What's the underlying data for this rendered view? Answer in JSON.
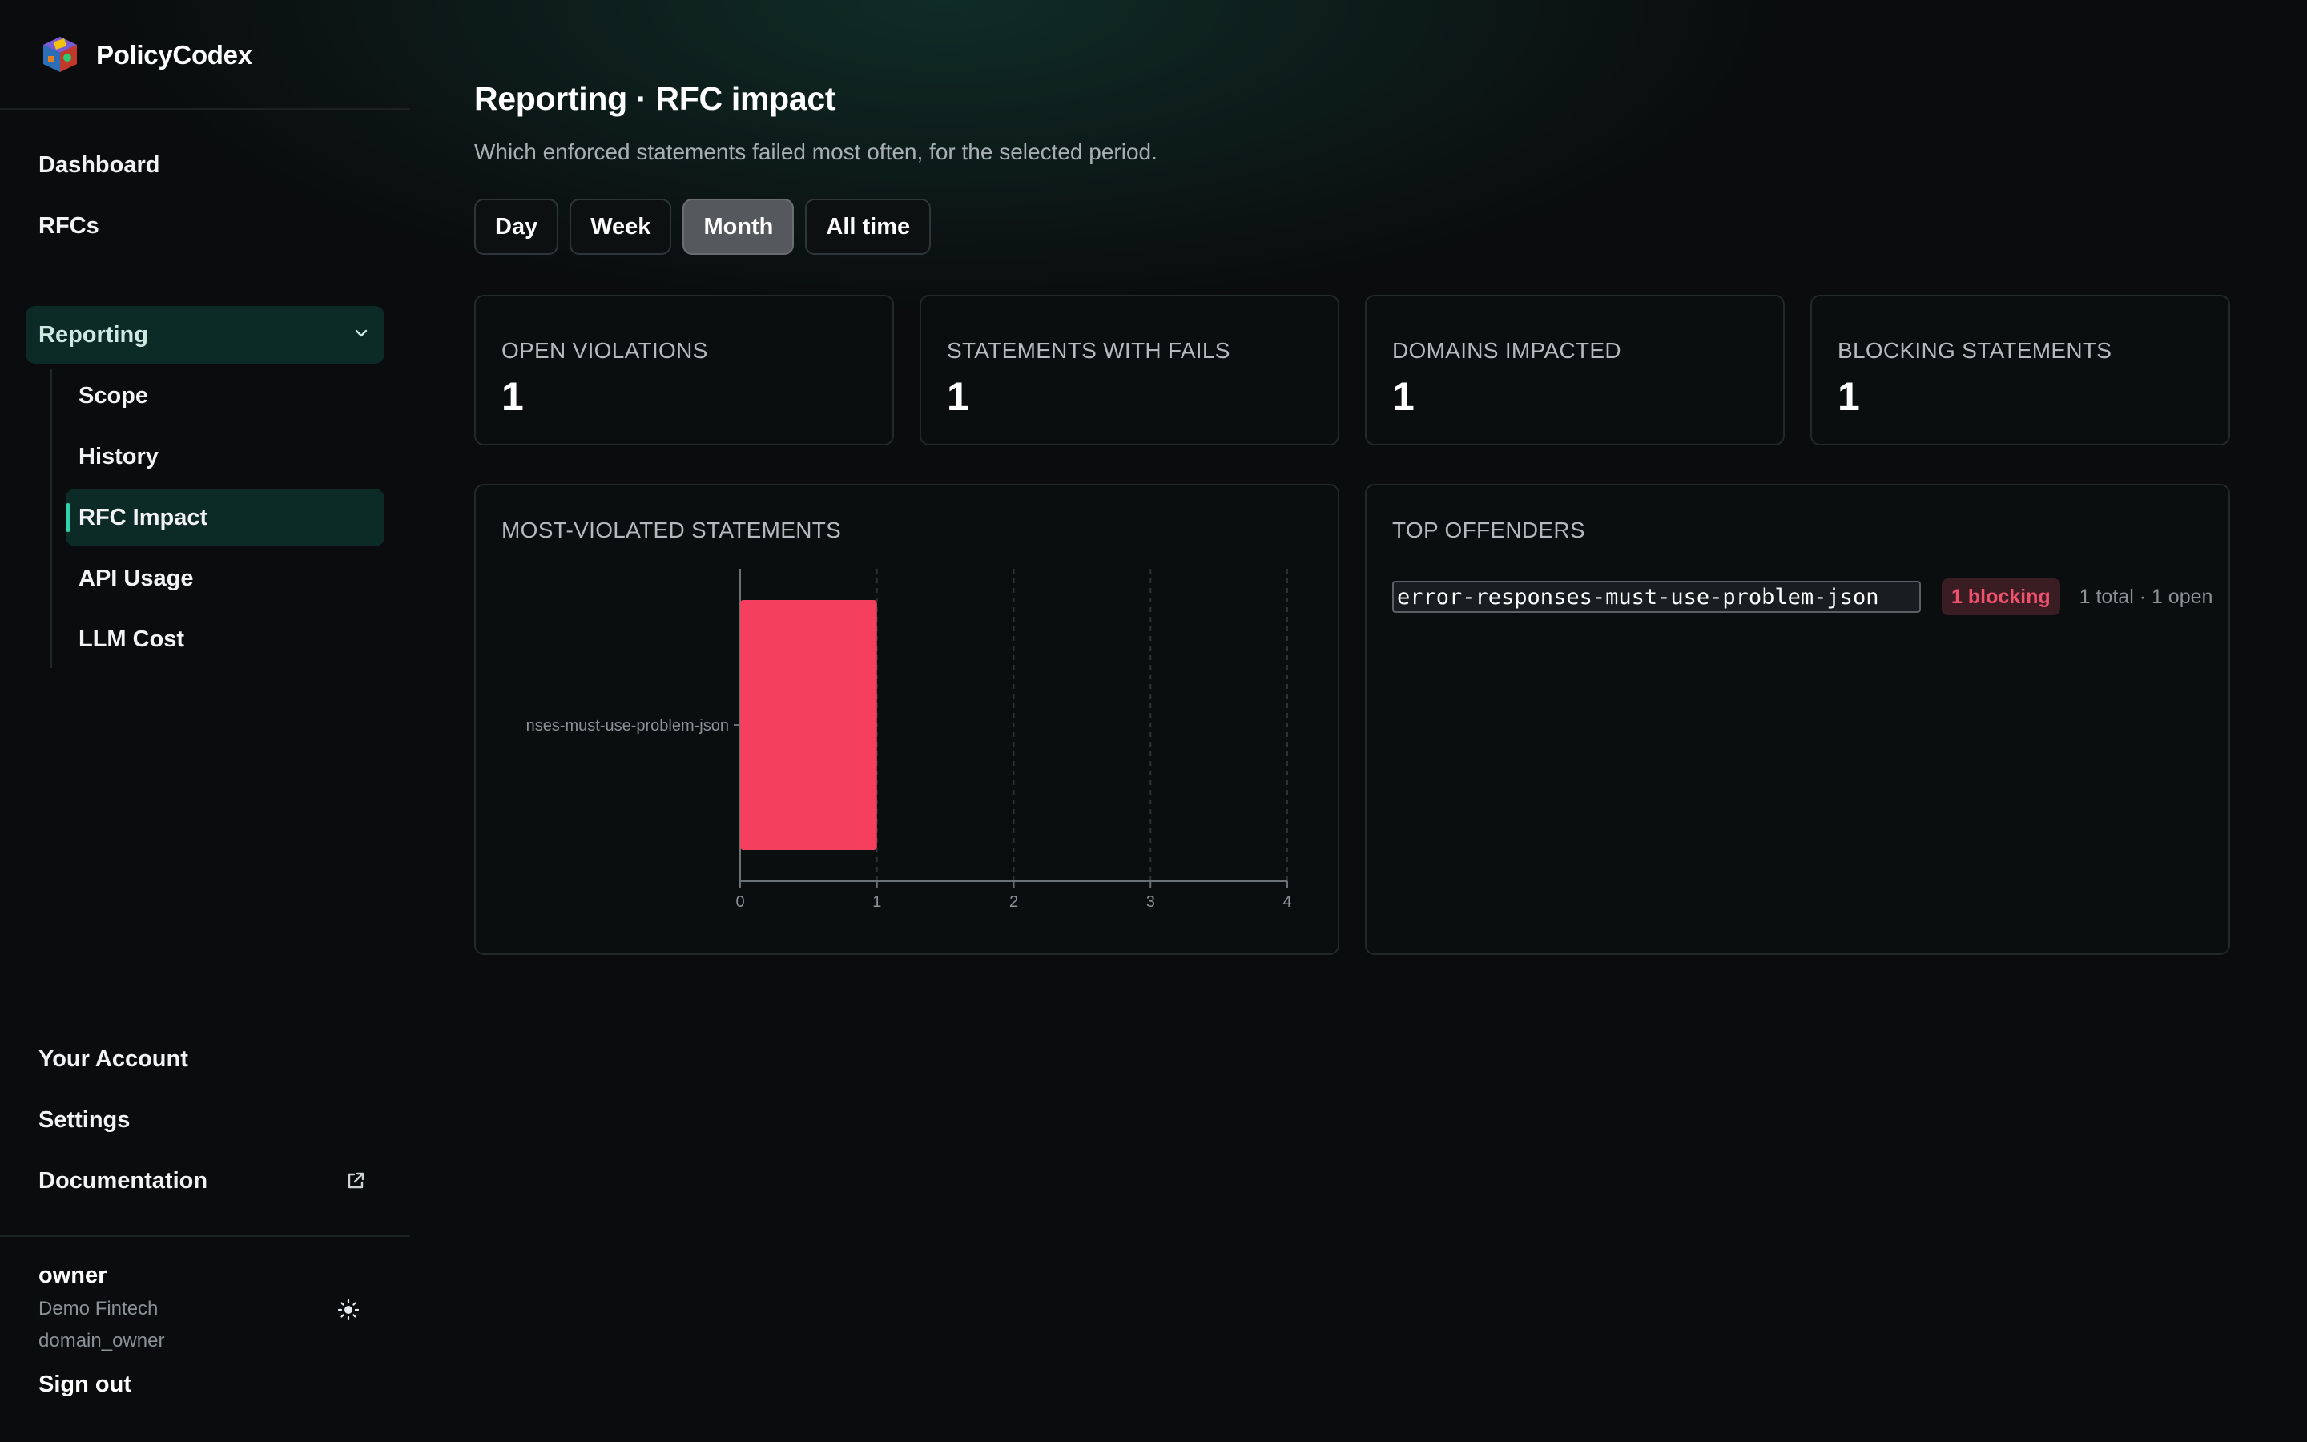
{
  "app": {
    "name": "PolicyCodex"
  },
  "sidebar": {
    "top_items": [
      "Dashboard",
      "RFCs"
    ],
    "group": {
      "label": "Reporting",
      "expanded": true
    },
    "sub_items": [
      "Scope",
      "History",
      "RFC Impact",
      "API Usage",
      "LLM Cost"
    ],
    "active_sub": "RFC Impact",
    "bottom_items": [
      "Your Account",
      "Settings",
      "Documentation"
    ]
  },
  "user": {
    "name": "owner",
    "org": "Demo Fintech",
    "role": "domain_owner",
    "sign_out": "Sign out"
  },
  "page": {
    "title": "Reporting · RFC impact",
    "subtitle": "Which enforced statements failed most often, for the selected period.",
    "periods": [
      "Day",
      "Week",
      "Month",
      "All time"
    ],
    "selected_period": "Month"
  },
  "kpis": [
    {
      "label": "OPEN VIOLATIONS",
      "value": "1"
    },
    {
      "label": "STATEMENTS WITH FAILS",
      "value": "1"
    },
    {
      "label": "DOMAINS IMPACTED",
      "value": "1"
    },
    {
      "label": "BLOCKING STATEMENTS",
      "value": "1"
    }
  ],
  "chart_panel": {
    "title": "MOST-VIOLATED STATEMENTS"
  },
  "chart_data": {
    "type": "bar",
    "orientation": "horizontal",
    "categories": [
      "error-responses-must-use-problem-json"
    ],
    "category_display": [
      "nses-must-use-problem-json"
    ],
    "values": [
      1
    ],
    "xlim": [
      0,
      4
    ],
    "xticks": [
      "0",
      "1",
      "2",
      "3",
      "4"
    ],
    "grid": true,
    "bar_color": "#f43f5e"
  },
  "offenders": {
    "title": "TOP OFFENDERS",
    "items": [
      {
        "statement": "error-responses-must-use-problem-json",
        "badge": "1 blocking",
        "counts": "1 total · 1 open"
      }
    ]
  },
  "colors": {
    "accent": "#2fd3ae",
    "danger": "#f43f5e"
  }
}
